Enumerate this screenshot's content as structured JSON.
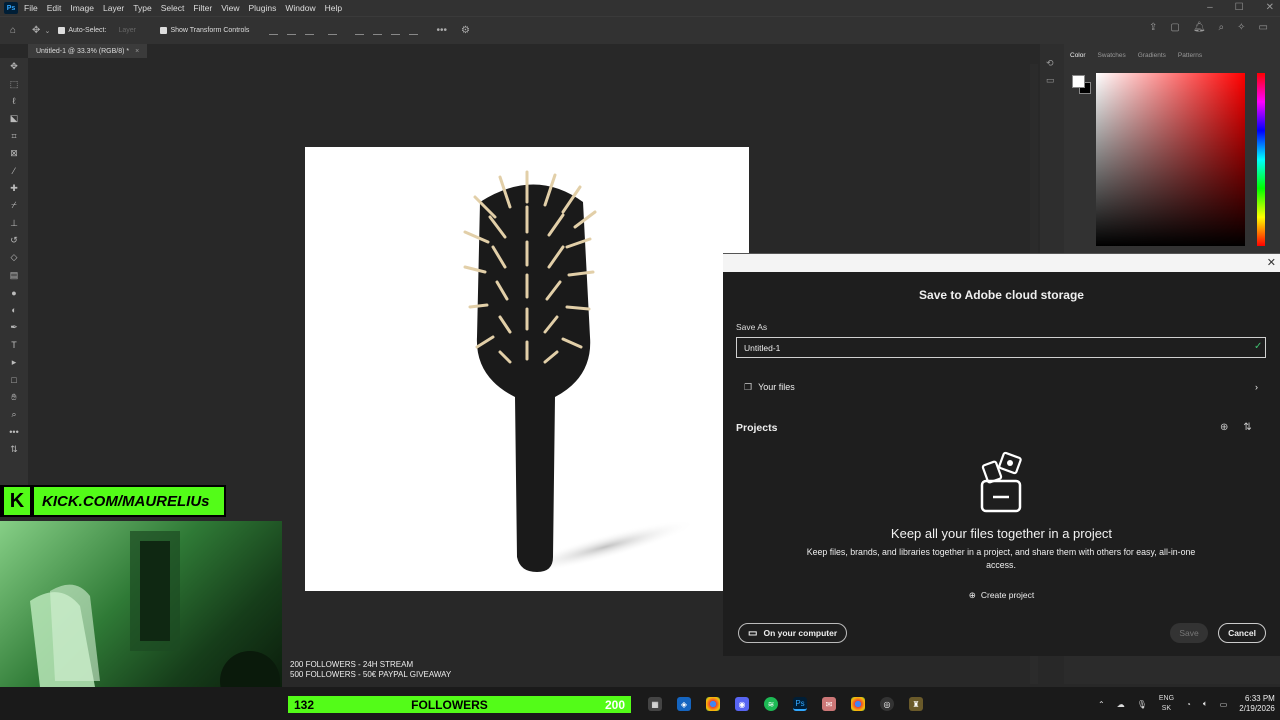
{
  "menu": [
    "File",
    "Edit",
    "Image",
    "Layer",
    "Type",
    "Select",
    "Filter",
    "View",
    "Plugins",
    "Window",
    "Help"
  ],
  "app_badge": "Ps",
  "options": {
    "auto_select": "Auto-Select:",
    "layer_dropdown": "Layer",
    "show_transform": "Show Transform Controls"
  },
  "doc_tab": "Untitled-1 @ 33.3% (RGB/8) *",
  "panel_tabs": [
    "Color",
    "Swatches",
    "Gradients",
    "Patterns"
  ],
  "dialog": {
    "title": "Save to Adobe cloud storage",
    "save_as_label": "Save As",
    "filename": "Untitled-1",
    "your_files": "Your files",
    "projects_label": "Projects",
    "empty_title": "Keep all your files together in a project",
    "empty_text": "Keep files, brands, and libraries together in a project, and share them with others for easy, all-in-one access.",
    "create_project": "Create project",
    "on_computer": "On your computer",
    "save": "Save",
    "cancel": "Cancel"
  },
  "stream": {
    "kick_url": "KICK.COM/MAURELIUs",
    "goal1": "200 FOLLOWERS - 24H STREAM",
    "goal2": "500 FOLLOWERS - 50€ PAYPAL GIVEAWAY",
    "followers_count": "132",
    "followers_label": "FOLLOWERS",
    "followers_goal": "200"
  },
  "tray": {
    "lang1": "ENG",
    "lang2": "SK",
    "time": "6:33 PM",
    "date": "2/19/2026"
  },
  "colors": {
    "kick_green": "#53fc18",
    "ps_blue": "#31a8ff",
    "fg_swatch": "#ffffff",
    "bg_swatch": "#000000"
  }
}
